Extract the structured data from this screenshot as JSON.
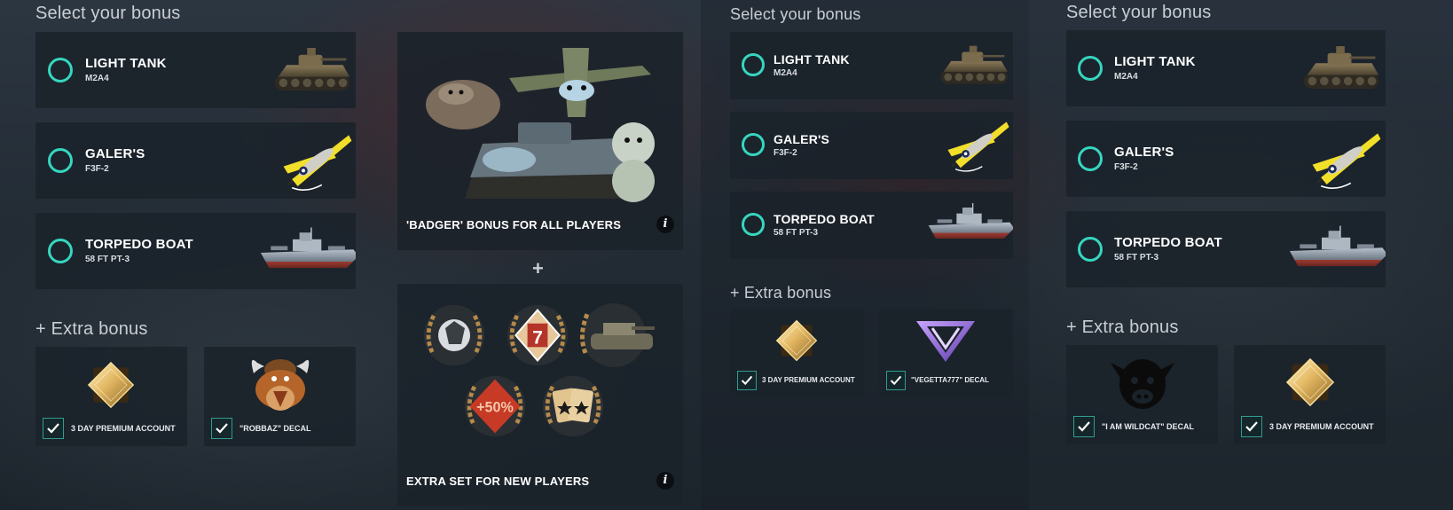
{
  "panel_a": {
    "title": "Select your bonus",
    "vehicles": [
      {
        "name": "LIGHT TANK",
        "model": "M2A4",
        "icon": "light-tank-icon"
      },
      {
        "name": "GALER'S",
        "model": "F3F-2",
        "icon": "biplane-icon"
      },
      {
        "name": "TORPEDO BOAT",
        "model": "58 FT PT-3",
        "icon": "torpedo-boat-icon"
      }
    ],
    "extra_title": "+ Extra bonus",
    "extras": [
      {
        "label": "3 DAY PREMIUM ACCOUNT",
        "icon": "premium-diamond-icon"
      },
      {
        "label": "\"ROBBAZ\" DECAL",
        "icon": "robbaz-decal-icon"
      }
    ]
  },
  "panel_b": {
    "badger_label": "'BADGER' BONUS FOR ALL PLAYERS",
    "plus": "+",
    "extra_set_label": "EXTRA SET FOR NEW PLAYERS",
    "info": "i",
    "badge_text_7": "7",
    "badge_text_50": "+50%"
  },
  "panel_c": {
    "title": "Select your bonus",
    "vehicles": [
      {
        "name": "LIGHT TANK",
        "model": "M2A4",
        "icon": "light-tank-icon"
      },
      {
        "name": "GALER'S",
        "model": "F3F-2",
        "icon": "biplane-icon"
      },
      {
        "name": "TORPEDO BOAT",
        "model": "58 FT PT-3",
        "icon": "torpedo-boat-icon"
      }
    ],
    "extra_title": "+ Extra bonus",
    "extras": [
      {
        "label": "3 DAY PREMIUM ACCOUNT",
        "icon": "premium-diamond-icon"
      },
      {
        "label": "\"VEGETTA777\" DECAL",
        "icon": "vegetta-decal-icon"
      }
    ]
  },
  "panel_d": {
    "title": "Select your bonus",
    "vehicles": [
      {
        "name": "LIGHT TANK",
        "model": "M2A4",
        "icon": "light-tank-icon"
      },
      {
        "name": "GALER'S",
        "model": "F3F-2",
        "icon": "biplane-icon"
      },
      {
        "name": "TORPEDO BOAT",
        "model": "58 FT PT-3",
        "icon": "torpedo-boat-icon"
      }
    ],
    "extra_title": "+ Extra bonus",
    "extras": [
      {
        "label": "\"I AM WILDCAT\" DECAL",
        "icon": "wildcat-decal-icon"
      },
      {
        "label": "3 DAY PREMIUM ACCOUNT",
        "icon": "premium-diamond-icon"
      }
    ]
  },
  "colors": {
    "accent": "#36d6c0",
    "card_bg": "#1a222a",
    "gold": "#e3b863"
  }
}
